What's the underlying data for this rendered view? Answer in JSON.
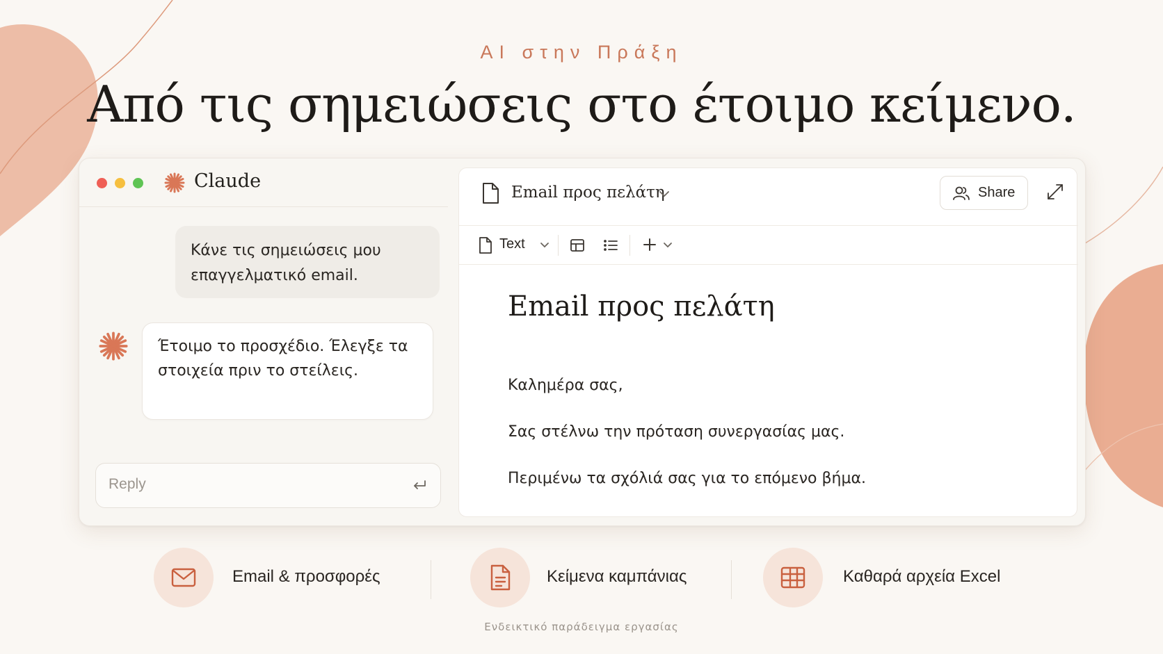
{
  "eyebrow": "AI στην Πράξη",
  "headline": "Από τις σημειώσεις στο έτοιμο κείμενο.",
  "app": {
    "name": "Claude",
    "window_controls": [
      "close",
      "minimize",
      "maximize"
    ]
  },
  "chat": {
    "user_message": "Κάνε τις σημειώσεις μου επαγγελματικό email.",
    "assistant_message": "Έτοιμο το προσχέδιο. Έλεγξε τα στοιχεία πριν το στείλεις.",
    "reply_placeholder": "Reply"
  },
  "document": {
    "tab_title": "Email προς πελάτη",
    "share_label": "Share",
    "toolbar": {
      "text_style": "Text"
    },
    "heading": "Email προς πελάτη",
    "paragraphs": [
      "Καλημέρα σας,",
      "Σας στέλνω την πρόταση συνεργασίας μας.",
      "Περιμένω τα σχόλιά σας για το επόμενο βήμα."
    ]
  },
  "features": [
    {
      "label": "Email & προσφορές",
      "icon": "mail-icon"
    },
    {
      "label": "Κείμενα καμπάνιας",
      "icon": "document-icon"
    },
    {
      "label": "Καθαρά αρχεία Excel",
      "icon": "spreadsheet-icon"
    }
  ],
  "footnote": "Ενδεικτικό παράδειγμα εργασίας",
  "colors": {
    "accent": "#d97757",
    "background": "#faf7f3",
    "blob": "#eaa88c"
  }
}
